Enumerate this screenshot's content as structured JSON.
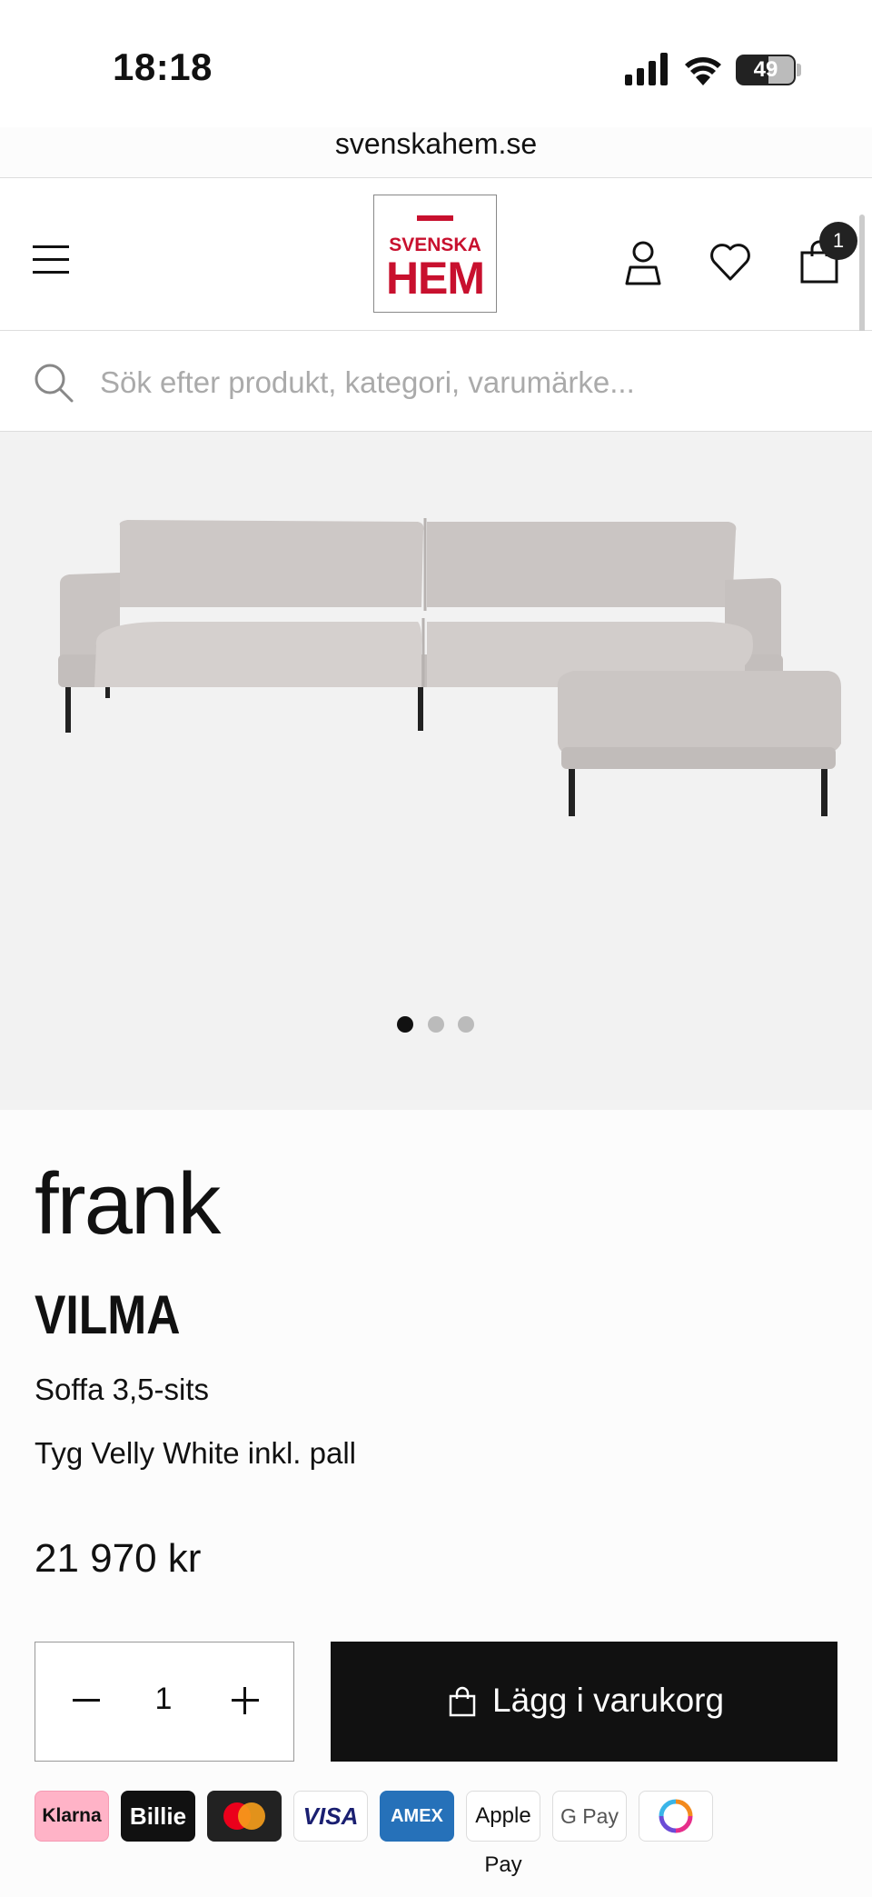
{
  "status_bar": {
    "time": "18:18",
    "battery": "49"
  },
  "browser": {
    "url": "svenskahem.se"
  },
  "header": {
    "logo_top": "SVENSKA",
    "logo_bottom": "HEM",
    "cart_count": "1"
  },
  "search": {
    "placeholder": "Sök efter produkt, kategori, varumärke..."
  },
  "gallery": {
    "slides": 3,
    "active_slide": 1
  },
  "product": {
    "brand": "frank",
    "name": "VILMA",
    "subtitle": "Soffa 3,5-sits",
    "variant": "Tyg Velly White inkl. pall",
    "price": "21 970 kr"
  },
  "cart": {
    "quantity": "1",
    "add_label": "Lägg i varukorg"
  },
  "payments": [
    "Klarna",
    "Billie",
    "Mastercard",
    "VISA",
    "AMEX",
    "Apple Pay",
    "G Pay",
    "Swish"
  ],
  "colors": {
    "brand_red": "#c8102e",
    "button_black": "#111111",
    "klarna_pink": "#ffb3c7",
    "amex_blue": "#2671b9"
  }
}
